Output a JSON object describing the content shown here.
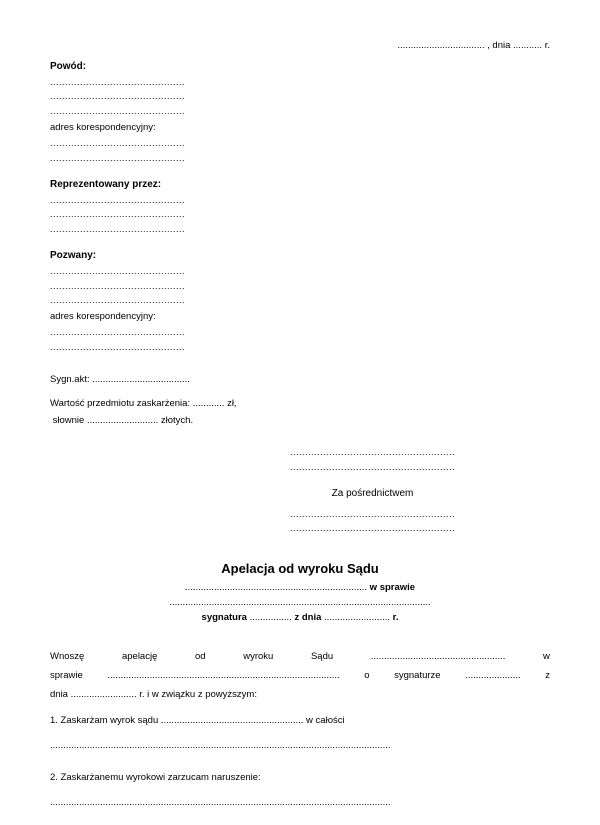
{
  "date": {
    "place_dots": ".................................",
    "label": ", dnia",
    "day_dots": "...........",
    "year_suffix": "r."
  },
  "plaintiff": {
    "label": "Powód:",
    "dots1": ".............................................",
    "dots2": ".............................................",
    "dots3": ".............................................",
    "addr_label": "adres korespondencyjny:",
    "addr_dots1": ".............................................",
    "addr_dots2": "............................................."
  },
  "representative": {
    "label": "Reprezentowany przez:",
    "dots1": ".............................................",
    "dots2": ".............................................",
    "dots3": "............................................."
  },
  "defendant": {
    "label": "Pozwany:",
    "dots1": ".............................................",
    "dots2": ".............................................",
    "dots3": ".............................................",
    "addr_label": "adres korespondencyjny:",
    "addr_dots1": ".............................................",
    "addr_dots2": "............................................."
  },
  "signature": {
    "label": "Sygn.akt:",
    "dots": "....................................."
  },
  "value": {
    "line1a": "Wartość przedmiotu zaskarżenia:",
    "line1_dots": "............",
    "line1b": "zł,",
    "line2a": "słownie",
    "line2_dots": "...........................",
    "line2b": "złotych."
  },
  "court_block": {
    "dots1": ".......................................................",
    "dots2": ".......................................................",
    "via": "Za pośrednictwem",
    "dots3": ".......................................................",
    "dots4": "......................................................."
  },
  "title": "Apelacja od wyroku Sądu",
  "subtitle": {
    "row1_dots": ".....................................................................",
    "row1_suffix": "w sprawie",
    "row2_dots": "...................................................................................................",
    "row3_prefix": "sygnatura",
    "row3_dots1": "................",
    "row3_mid": "z dnia",
    "row3_dots2": ".........................",
    "row3_suffix": "r."
  },
  "body": {
    "row1": {
      "t1": "Wnoszę",
      "t2": "apelację",
      "t3": "od",
      "t4": "wyroku",
      "t5": "Sądu",
      "dots": "...................................................",
      "t6": "w"
    },
    "row2": {
      "t1": "sprawie",
      "dots": "........................................................................................",
      "t2": "o",
      "t3": "sygnaturze",
      "dots2": ".....................",
      "t4": "z"
    },
    "row3": {
      "t1": "dnia",
      "dots": ".........................",
      "t2": "r. i w związku z powyższym:"
    },
    "item1": {
      "prefix": "1. Zaskarżam wyrok sądu",
      "dots": "......................................................",
      "suffix": "w całości"
    },
    "item1_dots": ".................................................................................................................................",
    "item2": {
      "text": "2. Zaskarżanemu wyrokowi zarzucam naruszenie:"
    },
    "item2_dots": "................................................................................................................................."
  }
}
